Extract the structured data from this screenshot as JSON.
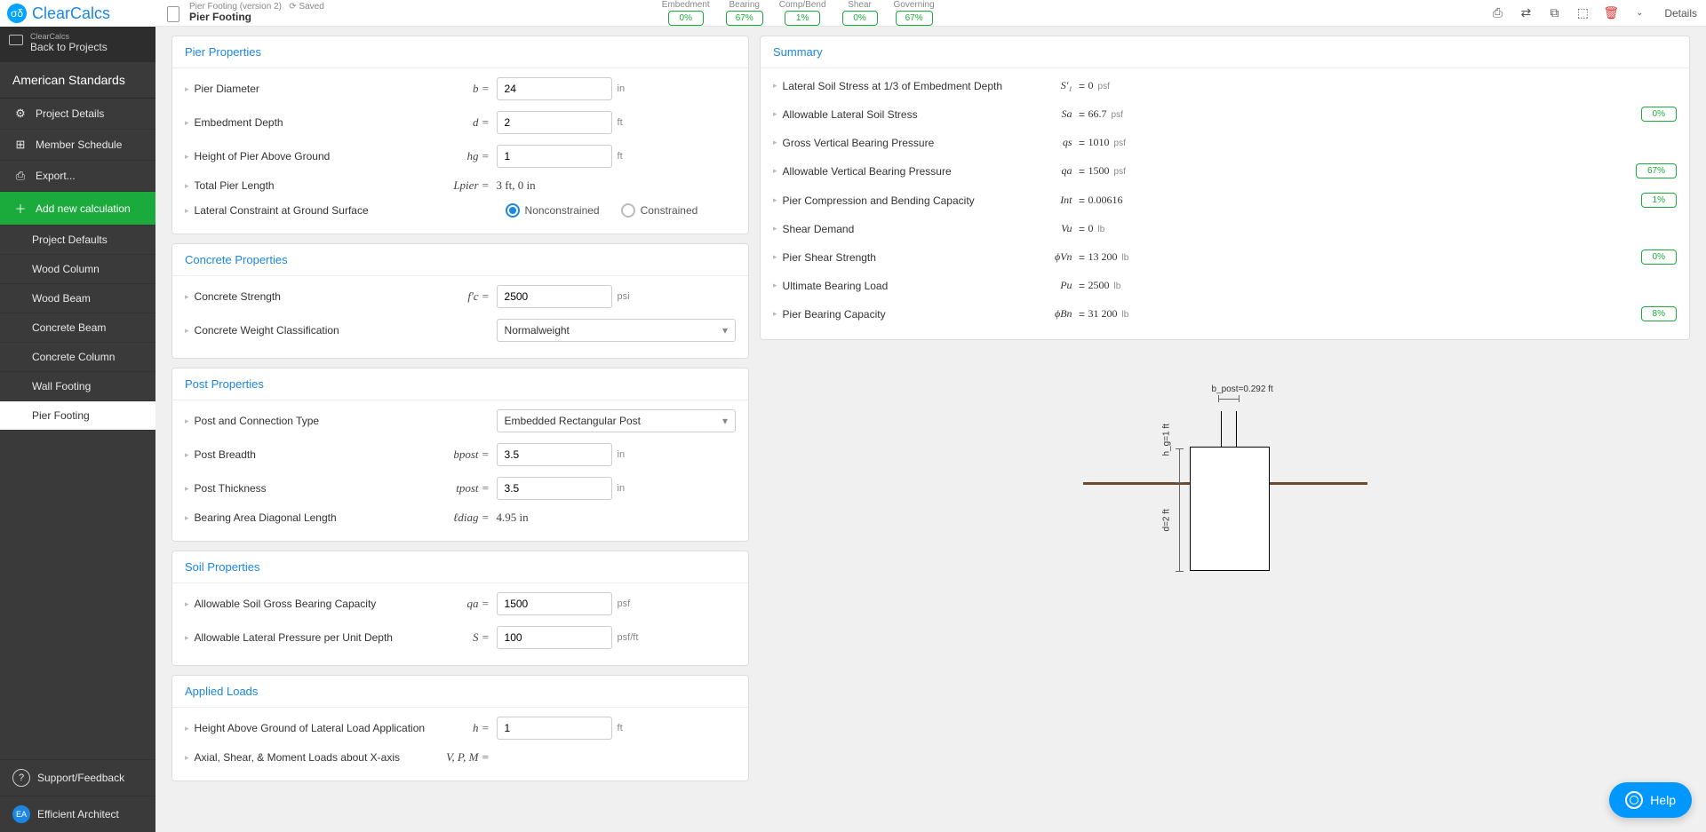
{
  "brand": "ClearCalcs",
  "sidebar": {
    "back_mini": "ClearCalcs",
    "back_label": "Back to Projects",
    "section": "American Standards",
    "items": [
      {
        "icon": "⚙",
        "label": "Project Details"
      },
      {
        "icon": "⊞",
        "label": "Member Schedule"
      },
      {
        "icon": "⎙",
        "label": "Export..."
      }
    ],
    "add_label": "Add new calculation",
    "calcs": [
      "Project Defaults",
      "Wood Column",
      "Wood Beam",
      "Concrete Beam",
      "Concrete Column",
      "Wall Footing",
      "Pier Footing"
    ],
    "active_calc": "Pier Footing",
    "bottom": [
      {
        "icon": "?",
        "label": "Support/Feedback"
      },
      {
        "icon": "EA",
        "label": "Efficient Architect"
      }
    ]
  },
  "header": {
    "breadcrumb": "Pier Footing (version 2)",
    "saved": "⟳ Saved",
    "title": "Pier Footing",
    "stats": [
      {
        "label": "Embedment",
        "value": "0%"
      },
      {
        "label": "Bearing",
        "value": "67%"
      },
      {
        "label": "Comp/Bend",
        "value": "1%"
      },
      {
        "label": "Shear",
        "value": "0%"
      },
      {
        "label": "Governing",
        "value": "67%"
      }
    ],
    "details": "Details"
  },
  "cards": {
    "pier": {
      "title": "Pier Properties",
      "rows": [
        {
          "label": "Pier Diameter",
          "sym": "b =",
          "value": "24",
          "unit": "in"
        },
        {
          "label": "Embedment Depth",
          "sym": "d =",
          "value": "2",
          "unit": "ft"
        },
        {
          "label": "Height of Pier Above Ground",
          "sym": "hg =",
          "value": "1",
          "unit": "ft"
        },
        {
          "label": "Total Pier Length",
          "sym": "Lpier =",
          "static": "3 ft, 0 in"
        },
        {
          "label": "Lateral Constraint at Ground Surface",
          "radio": true,
          "opt1": "Nonconstrained",
          "opt2": "Constrained"
        }
      ]
    },
    "concrete": {
      "title": "Concrete Properties",
      "rows": [
        {
          "label": "Concrete Strength",
          "sym": "f'c =",
          "value": "2500",
          "unit": "psi"
        },
        {
          "label": "Concrete Weight Classification",
          "select": "Normalweight"
        }
      ]
    },
    "post": {
      "title": "Post Properties",
      "rows": [
        {
          "label": "Post and Connection Type",
          "select": "Embedded Rectangular Post"
        },
        {
          "label": "Post Breadth",
          "sym": "bpost =",
          "value": "3.5",
          "unit": "in"
        },
        {
          "label": "Post Thickness",
          "sym": "tpost =",
          "value": "3.5",
          "unit": "in"
        },
        {
          "label": "Bearing Area Diagonal Length",
          "sym": "ℓdiag =",
          "static": "4.95 in"
        }
      ]
    },
    "soil": {
      "title": "Soil Properties",
      "rows": [
        {
          "label": "Allowable Soil Gross Bearing Capacity",
          "sym": "qa =",
          "value": "1500",
          "unit": "psf"
        },
        {
          "label": "Allowable Lateral Pressure per Unit Depth",
          "sym": "S =",
          "value": "100",
          "unit": "psf/ft"
        }
      ]
    },
    "loads": {
      "title": "Applied Loads",
      "rows": [
        {
          "label": "Height Above Ground of Lateral Load Application",
          "sym": "h =",
          "value": "1",
          "unit": "ft"
        },
        {
          "label": "Axial, Shear, & Moment Loads about X-axis",
          "sym": "V, P, M ="
        }
      ]
    }
  },
  "summary": {
    "title": "Summary",
    "rows": [
      {
        "label": "Lateral Soil Stress at 1/3 of Embedment Depth",
        "sym": "S'₁",
        "val": "0",
        "unit": "psf"
      },
      {
        "label": "Allowable Lateral Soil Stress",
        "sym": "Sa",
        "val": "66.7",
        "unit": "psf",
        "pill": "0%"
      },
      {
        "label": "Gross Vertical Bearing Pressure",
        "sym": "qs",
        "val": "1010",
        "unit": "psf"
      },
      {
        "label": "Allowable Vertical Bearing Pressure",
        "sym": "qa",
        "val": "1500",
        "unit": "psf",
        "pill": "67%"
      },
      {
        "label": "Pier Compression and Bending Capacity",
        "sym": "Int",
        "val": "0.00616",
        "unit": "",
        "pill": "1%"
      },
      {
        "label": "Shear Demand",
        "sym": "Vu",
        "val": "0",
        "unit": "lb"
      },
      {
        "label": "Pier Shear Strength",
        "sym": "ϕVn",
        "val": "13 200",
        "unit": "lb",
        "pill": "0%"
      },
      {
        "label": "Ultimate Bearing Load",
        "sym": "Pu",
        "val": "2500",
        "unit": "lb"
      },
      {
        "label": "Pier Bearing Capacity",
        "sym": "ϕBn",
        "val": "31 200",
        "unit": "lb",
        "pill": "8%"
      }
    ]
  },
  "diagram": {
    "bpost": "b_post=0.292 ft",
    "hg": "h_g=1 ft",
    "d": "d=2 ft"
  },
  "help": "Help"
}
